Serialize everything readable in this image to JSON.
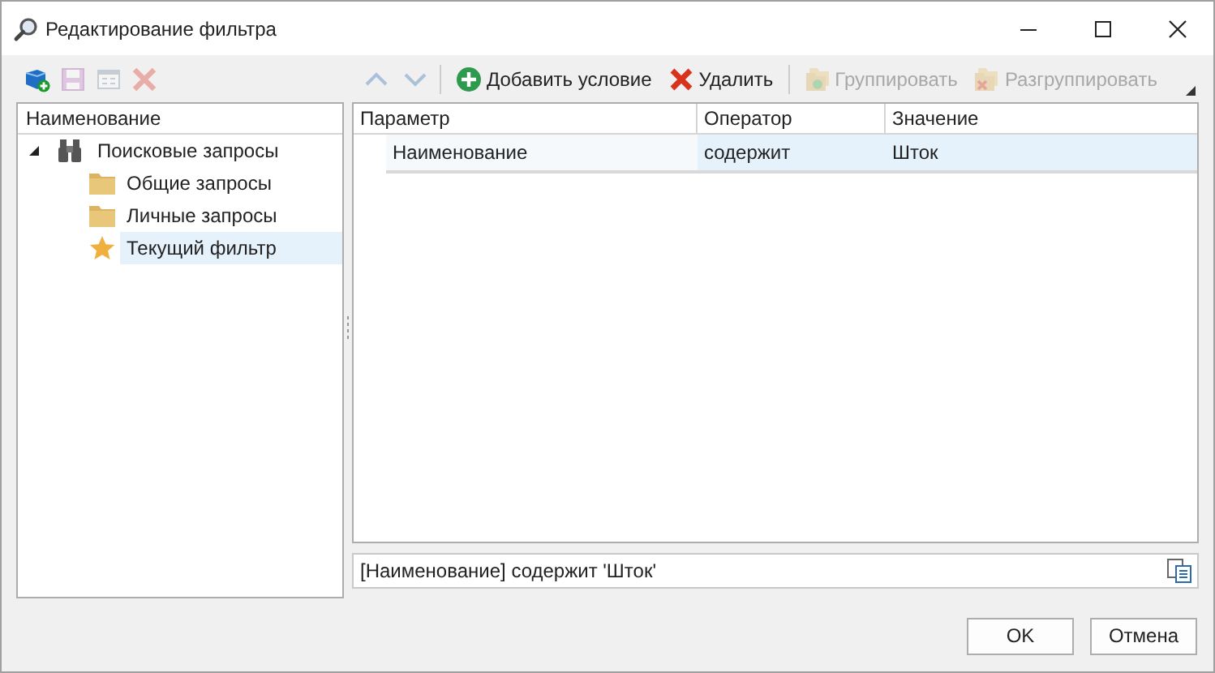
{
  "window": {
    "title": "Редактирование фильтра"
  },
  "left_toolbar": [
    {
      "kind": "add",
      "disabled": false
    },
    {
      "kind": "save",
      "disabled": true
    },
    {
      "kind": "view",
      "disabled": true
    },
    {
      "kind": "delete",
      "disabled": true
    }
  ],
  "tree": {
    "column": "Наименование",
    "items": [
      {
        "label": "Поисковые запросы",
        "kind": "binoculars",
        "expanded": true,
        "selected": false,
        "children": [
          {
            "label": "Общие запросы",
            "kind": "folder",
            "selected": false
          },
          {
            "label": "Личные запросы",
            "kind": "folder",
            "selected": false
          },
          {
            "label": "Текущий фильтр",
            "kind": "star",
            "selected": true
          }
        ]
      }
    ]
  },
  "toolbar": [
    {
      "kind": "up",
      "disabled": true
    },
    {
      "kind": "down",
      "disabled": true
    },
    {
      "kind": "add",
      "label": "Добавить условие",
      "disabled": false
    },
    {
      "kind": "delete",
      "label": "Удалить",
      "disabled": false
    },
    {
      "kind": "group",
      "label": "Группировать",
      "disabled": true
    },
    {
      "kind": "ungroup",
      "label": "Разгруппировать",
      "disabled": true
    }
  ],
  "conditions": {
    "columns": [
      "Параметр",
      "Оператор",
      "Значение"
    ],
    "rows": [
      {
        "cells": [
          "Наименование",
          "содержит",
          "Шток"
        ],
        "selected": true
      }
    ]
  },
  "expression": "[Наименование] содержит 'Шток'",
  "buttons": [
    "OK",
    "Отмена"
  ]
}
